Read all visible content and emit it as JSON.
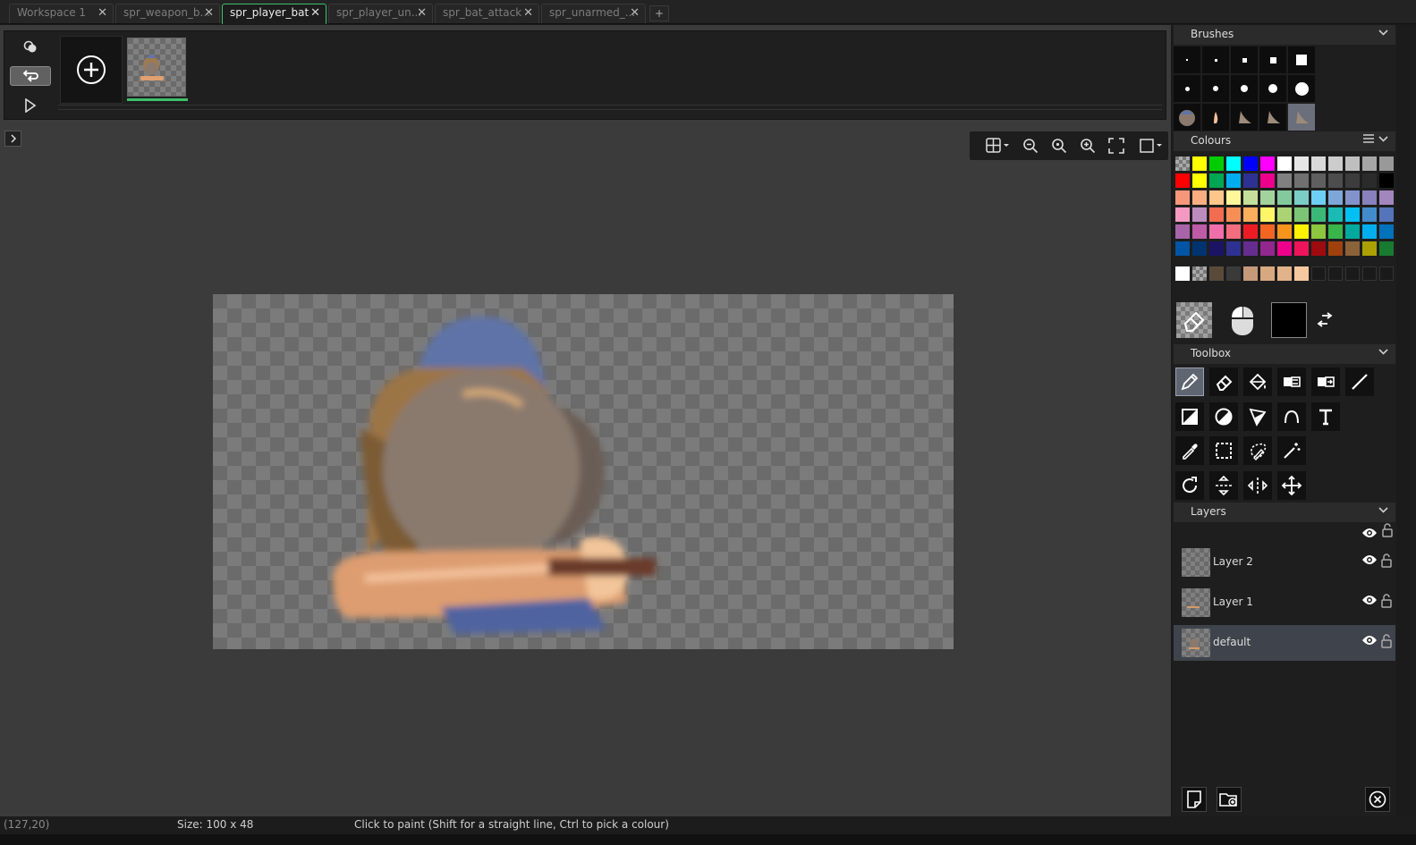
{
  "tabs": [
    {
      "label": "Workspace 1",
      "active": false
    },
    {
      "label": "spr_weapon_b...",
      "active": false
    },
    {
      "label": "spr_player_bat",
      "active": true
    },
    {
      "label": "spr_player_un...",
      "active": false
    },
    {
      "label": "spr_bat_attack",
      "active": false
    },
    {
      "label": "spr_unarmed_...",
      "active": false
    }
  ],
  "tab_add_label": "+",
  "tab_close_glyph": "✕",
  "panels": {
    "brushes": "Brushes",
    "colours": "Colours",
    "toolbox": "Toolbox",
    "layers": "Layers"
  },
  "layers": [
    {
      "name": "Layer 2",
      "selected": false
    },
    {
      "name": "Layer 1",
      "selected": false
    },
    {
      "name": "default",
      "selected": true
    }
  ],
  "status": {
    "coords": "(127,20)",
    "size": "Size: 100 x 48",
    "hint": "Click to paint (Shift for a straight line, Ctrl to pick a colour)"
  },
  "colors": {
    "accent": "#3fbf6b",
    "foreground_colour": "#000000",
    "palette_rows": [
      [
        "checker",
        "#ffff00",
        "#00cc00",
        "#00ffff",
        "#0000ff",
        "#ff00ff",
        "#ffffff",
        "#e6e6e6",
        "#d9d9d9",
        "#cccccc",
        "#bfbfbf",
        "#a6a6a6",
        "#999999"
      ],
      [
        "#ff0000",
        "#ffff00",
        "#00a651",
        "#00aeef",
        "#2e3192",
        "#ec008c",
        "#808080",
        "#707070",
        "#5f5f5f",
        "#4d4d4d",
        "#3c3c3c",
        "#2b2b2b",
        "#000000"
      ],
      [
        "#f7977a",
        "#f9ad81",
        "#fdc68a",
        "#fff79a",
        "#c4df9b",
        "#a3d39c",
        "#82ca9d",
        "#7bcdc8",
        "#6dcff6",
        "#7da7d9",
        "#8393ca",
        "#8781bd",
        "#a187be"
      ],
      [
        "#f49ac2",
        "#bd8cbf",
        "#f26c4f",
        "#f68e56",
        "#fbaf5d",
        "#fff568",
        "#acd373",
        "#7cc576",
        "#3bb878",
        "#1abbb4",
        "#00bff3",
        "#438ccb",
        "#5574b9"
      ],
      [
        "#a864a8",
        "#bd5ba7",
        "#f06eaa",
        "#f26d7d",
        "#ed1c24",
        "#f26522",
        "#f7941d",
        "#fff200",
        "#8dc63f",
        "#39b54a",
        "#00a99d",
        "#00aeef",
        "#0072bc"
      ],
      [
        "#0054a6",
        "#003471",
        "#1b1464",
        "#2e3192",
        "#662d91",
        "#92278f",
        "#ec008c",
        "#ed145b",
        "#9e0b0f",
        "#a0410d",
        "#8c6239",
        "#aba000",
        "#197b30"
      ]
    ],
    "custom_row": [
      "#ffffff",
      "checker",
      "#5a4a3a",
      "#3a3a3a",
      "#c49a7a",
      "#d8a880",
      "#e2b28a",
      "#f6c8a0",
      "#1a1a1a",
      "#1a1a1a",
      "#1a1a1a",
      "#1a1a1a",
      "#1a1a1a"
    ]
  },
  "brushes": {
    "row1": [
      "dot-1",
      "dot-2",
      "dot-3",
      "dot-4",
      "dot-5"
    ],
    "row2": [
      "round-1",
      "round-2",
      "round-3",
      "round-4",
      "round-5"
    ],
    "row3": [
      "custom-sprite",
      "custom-blade",
      "custom-shape-1",
      "custom-shape-2",
      "custom-shape-3"
    ]
  },
  "toolbox": [
    [
      "pencil-icon",
      "eraser-icon",
      "fill-icon",
      "replace-colour-icon",
      "swap-colour-icon",
      "line-icon"
    ],
    [
      "rectangle-icon",
      "ellipse-icon",
      "polygon-icon",
      "curve-icon",
      "text-icon"
    ],
    [
      "eyedropper-icon",
      "rect-select-icon",
      "lasso-icon",
      "magic-wand-icon"
    ],
    [
      "rotate-icon",
      "flip-vertical-icon",
      "flip-horizontal-icon",
      "move-icon"
    ]
  ]
}
